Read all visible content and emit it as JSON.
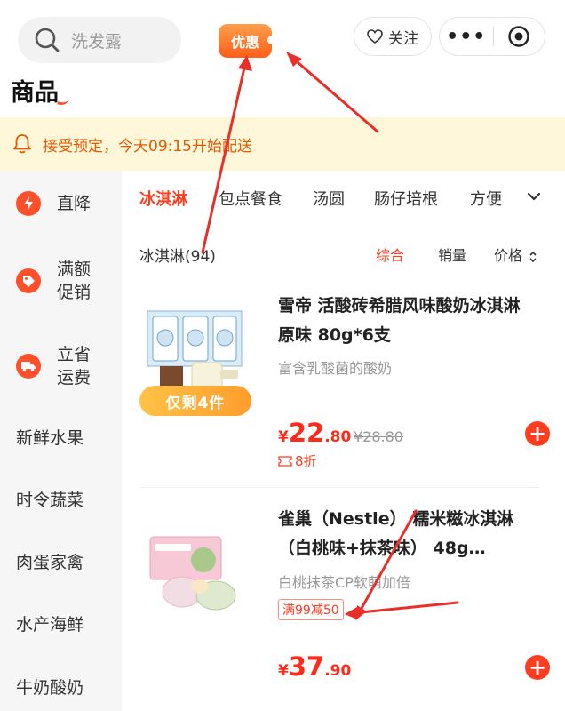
{
  "header": {
    "search_placeholder": "洗发露",
    "coupon_label": "优惠",
    "follow_label": "关注",
    "more_label": "•••"
  },
  "page_title": "商品",
  "notice": "接受预定，今天09:15开始配送",
  "sidebar": {
    "items": [
      {
        "label": "直降",
        "icon": "lightning-icon"
      },
      {
        "label": "满额\n促销",
        "icon": "tag-icon"
      },
      {
        "label": "立省\n运费",
        "icon": "truck-icon"
      },
      {
        "label": "新鲜水果"
      },
      {
        "label": "时令蔬菜"
      },
      {
        "label": "肉蛋家禽"
      },
      {
        "label": "水产海鲜"
      },
      {
        "label": "牛奶酸奶"
      }
    ]
  },
  "categories": [
    "冰淇淋",
    "包点餐食",
    "汤圆",
    "肠仔培根",
    "方便"
  ],
  "list": {
    "count_label": "冰淇淋(94)",
    "sort": [
      "综合",
      "销量",
      "价格"
    ]
  },
  "products": [
    {
      "title": "雪帝 活酸砖希腊风味酸奶冰淇淋 原味 80g*6支",
      "subtitle": "富含乳酸菌的酸奶",
      "badge": "仅剩4件",
      "currency": "¥",
      "price_int": "22",
      "price_dec": ".80",
      "original_price": "¥28.80",
      "discount": "8折"
    },
    {
      "title": "雀巢（Nestle） 糯米糍冰淇淋（白桃味+抹茶味） 48g…",
      "subtitle": "白桃抹茶CP软萌加倍",
      "promo": "满99减50",
      "currency": "¥",
      "price_int": "37",
      "price_dec": ".90"
    }
  ],
  "colors": {
    "accent": "#ff3c1e",
    "notice_bg": "#fff7d9",
    "notice_text": "#e35a00",
    "annotation": "#e8302a"
  }
}
